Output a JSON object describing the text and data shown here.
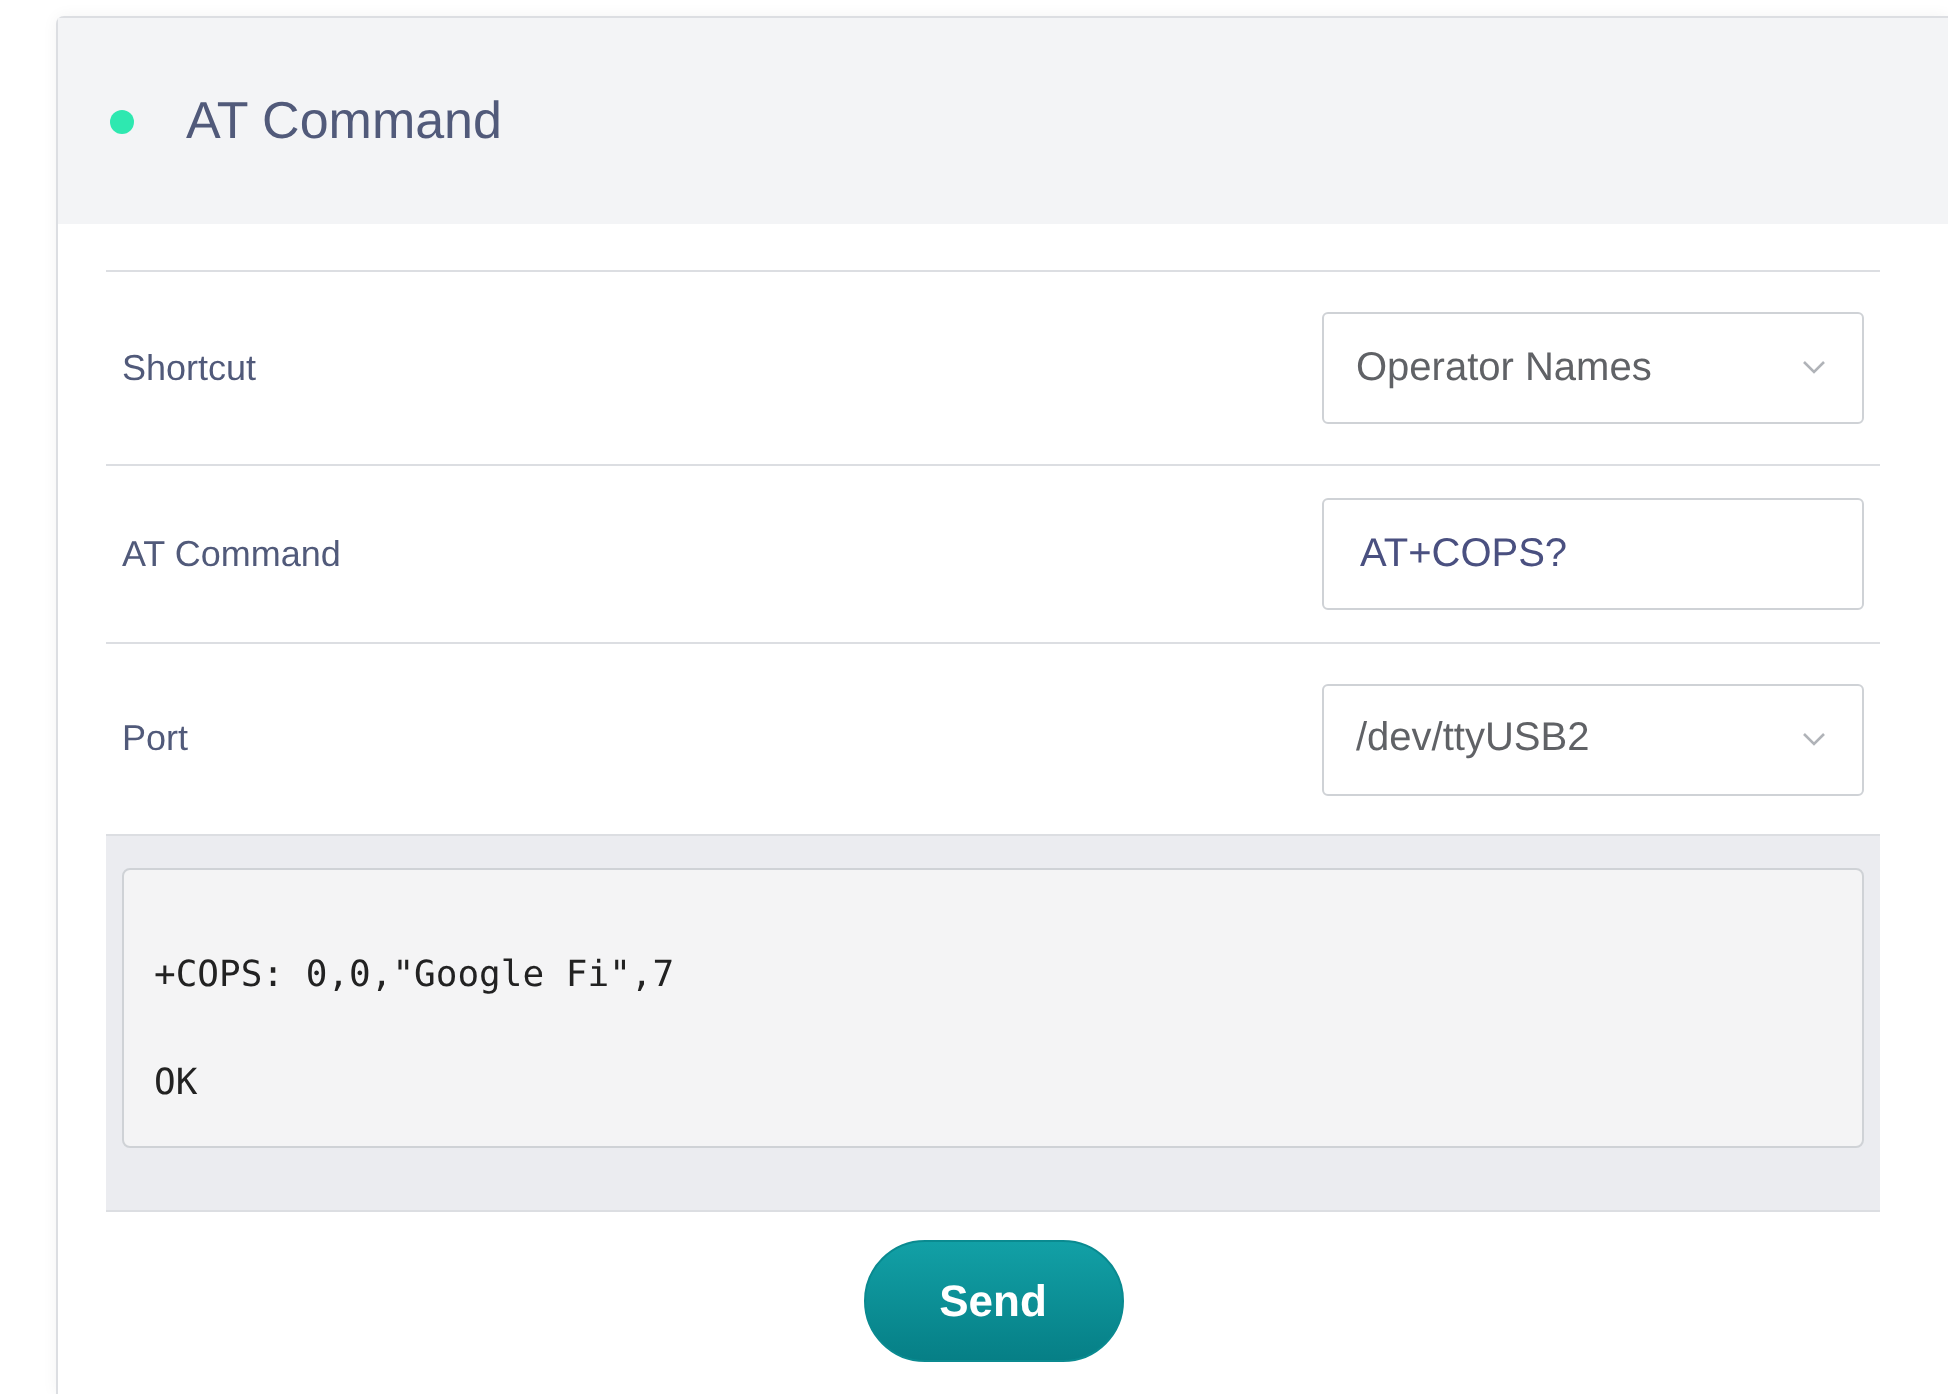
{
  "panel": {
    "title": "AT Command",
    "color": "#2ee8b0"
  },
  "fields": [
    {
      "label": "Shortcut",
      "kind": "select",
      "value": "Operator Names"
    },
    {
      "label": "AT Command",
      "kind": "input",
      "value": "AT+COPS?"
    },
    {
      "label": "Port",
      "kind": "select",
      "value": "/dev/ttyUSB2"
    }
  ],
  "output": {
    "text": "\n+COPS: 0,0,\"Google Fi\",7\n\nOK"
  },
  "send_button": "Send"
}
